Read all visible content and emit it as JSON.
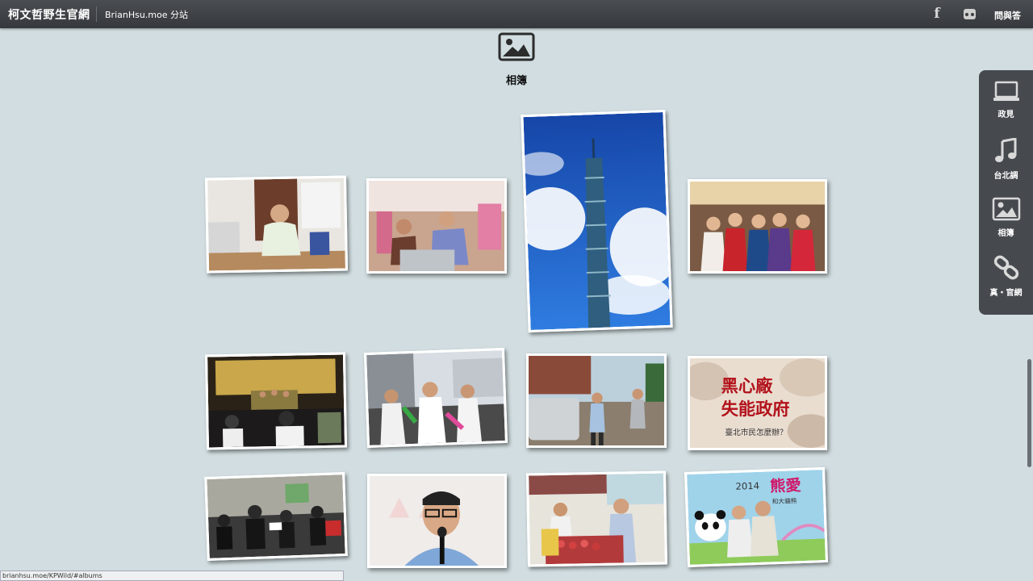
{
  "header": {
    "site_title": "柯文哲野生官網",
    "subsite_link": "BrianHsu.moe 分站",
    "social": {
      "facebook_icon": "facebook-icon",
      "flickr_icon": "flickr-icon"
    },
    "qa_link": "問與答"
  },
  "album": {
    "icon": "image-icon",
    "title": "相簿"
  },
  "sidenav": {
    "items": [
      {
        "label": "政見",
        "icon": "laptop-icon"
      },
      {
        "label": "台北調",
        "icon": "music-note-icon"
      },
      {
        "label": "相簿",
        "icon": "image-icon"
      },
      {
        "label": "真・官網",
        "icon": "link-icon"
      }
    ]
  },
  "photos": [
    {
      "name": "photo-meeting-desk"
    },
    {
      "name": "photo-market-handshake"
    },
    {
      "name": "photo-taipei-101"
    },
    {
      "name": "photo-group-women"
    },
    {
      "name": "photo-theater-stage"
    },
    {
      "name": "photo-street-campaign"
    },
    {
      "name": "photo-street-walk"
    },
    {
      "name": "photo-poster-text",
      "text_line1": "黑心廠",
      "text_line2": "失能政府",
      "text_line3": "臺北市民怎麼辦？"
    },
    {
      "name": "photo-orchestra"
    },
    {
      "name": "photo-portrait-mic"
    },
    {
      "name": "photo-fruit-market"
    },
    {
      "name": "photo-panda-event",
      "text_year": "2014",
      "text_title": "熊愛",
      "text_sub": "和大貓熊"
    }
  ],
  "status_bar": {
    "url": "brianhsu.moe/KPWild/#albums"
  },
  "colors": {
    "background": "#d1dde0",
    "topbar": "#3b3e42",
    "sidenav": "#464a4f",
    "poster_red": "#b3121b"
  }
}
